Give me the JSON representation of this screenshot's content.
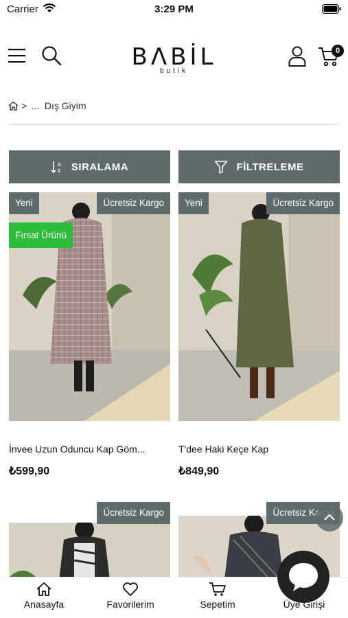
{
  "status_bar": {
    "carrier": "Carrier",
    "time": "3:29 PM"
  },
  "header": {
    "logo_main": "BΛBİL",
    "logo_sub": "butik",
    "cart_count": "0"
  },
  "breadcrumb": {
    "ellipsis": "...",
    "current": "Dış Giyim"
  },
  "toolbar": {
    "sort_label": "SIRALAMA",
    "filter_label": "FİLTRELEME"
  },
  "products": [
    {
      "name": "İnvee Uzun Oduncu Kap Göm...",
      "price": "₺599,90",
      "badge_new": "Yeni",
      "badge_cargo": "Ücretsiz Kargo",
      "badge_deal": "Fırsat Ürünü"
    },
    {
      "name": "T'dee Haki Keçe Kap",
      "price": "₺849,90",
      "badge_new": "Yeni",
      "badge_cargo": "Ücretsiz Kargo"
    },
    {
      "badge_cargo": "Ücretsiz Kargo"
    },
    {
      "badge_cargo": "Ücretsiz Kargo"
    }
  ],
  "bottom_nav": {
    "home": "Anasayfa",
    "favorites": "Favorilerim",
    "cart": "Sepetim",
    "login": "Üye Girişi"
  },
  "colors": {
    "accent": "#5f6b6b",
    "deal": "#2ebd3b"
  }
}
